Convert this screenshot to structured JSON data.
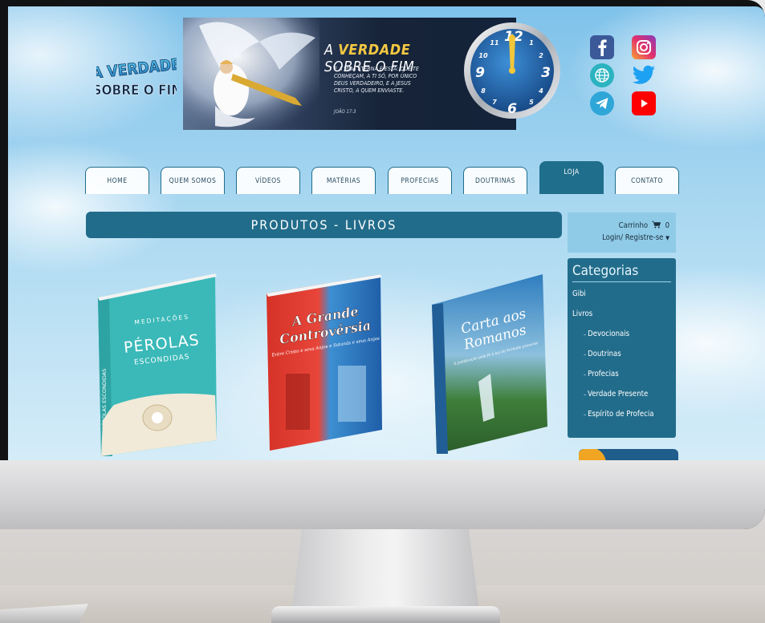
{
  "banner": {
    "title_bold": "VERDADE",
    "title_prefix": "A",
    "title_suffix": "SOBRE O FIM",
    "verse": "E A VIDA ETERNA É ESTA: QUE TE CONHEÇAM, A TI SÓ, POR ÚNICO DEUS VERDADEIRO, E A JESUS CRISTO, A QUEM ENVIASTE.",
    "reference": "JOÃO 17:3"
  },
  "logo": {
    "line1": "A VERDADE",
    "line2": "SOBRE O FIM"
  },
  "nav": {
    "tabs": [
      {
        "label": "HOME"
      },
      {
        "label": "QUEM SOMOS"
      },
      {
        "label": "VÍDEOS"
      },
      {
        "label": "MATÉRIAS"
      },
      {
        "label": "PROFECIAS"
      },
      {
        "label": "DOUTRINAS"
      },
      {
        "label": "LOJA"
      },
      {
        "label": "CONTATO"
      }
    ]
  },
  "main": {
    "heading": "PRODUTOS - LIVROS"
  },
  "cart": {
    "label": "Carrinho",
    "count": "0",
    "login": "Login/ Registre-se"
  },
  "categories": {
    "title": "Categorias",
    "items": [
      {
        "label": "Gibi"
      },
      {
        "label": "Livros"
      },
      {
        "label": "Devocionais"
      },
      {
        "label": "Doutrinas"
      },
      {
        "label": "Profecias"
      },
      {
        "label": "Verdade Presente"
      },
      {
        "label": "Espírito de Profecia"
      }
    ]
  },
  "books": [
    {
      "top": "MEDITAÇÕES",
      "title": "PÉROLAS",
      "subtitle": "ESCONDIDAS",
      "spine": "PÉROLAS ESCONDIDAS"
    },
    {
      "title1": "A Grande",
      "title2": "Controvérsia",
      "subtitle": "Entre Cristo e seus Anjos e Satanás e seus Anjos"
    },
    {
      "title1": "Carta aos",
      "title2": "Romanos",
      "subtitle": "A justificação pela fé à luz da Verdade presente"
    }
  ],
  "clock": {
    "numerals": [
      "12",
      "1",
      "2",
      "3",
      "4",
      "5",
      "6",
      "7",
      "8",
      "9",
      "10",
      "11"
    ]
  },
  "colors": {
    "primary": "#226c8b",
    "nav_border": "#1f6e8c",
    "cart_bg": "#8fcbe7",
    "clock_face": "#1c5ea8",
    "accent_gold": "#f5c842"
  }
}
